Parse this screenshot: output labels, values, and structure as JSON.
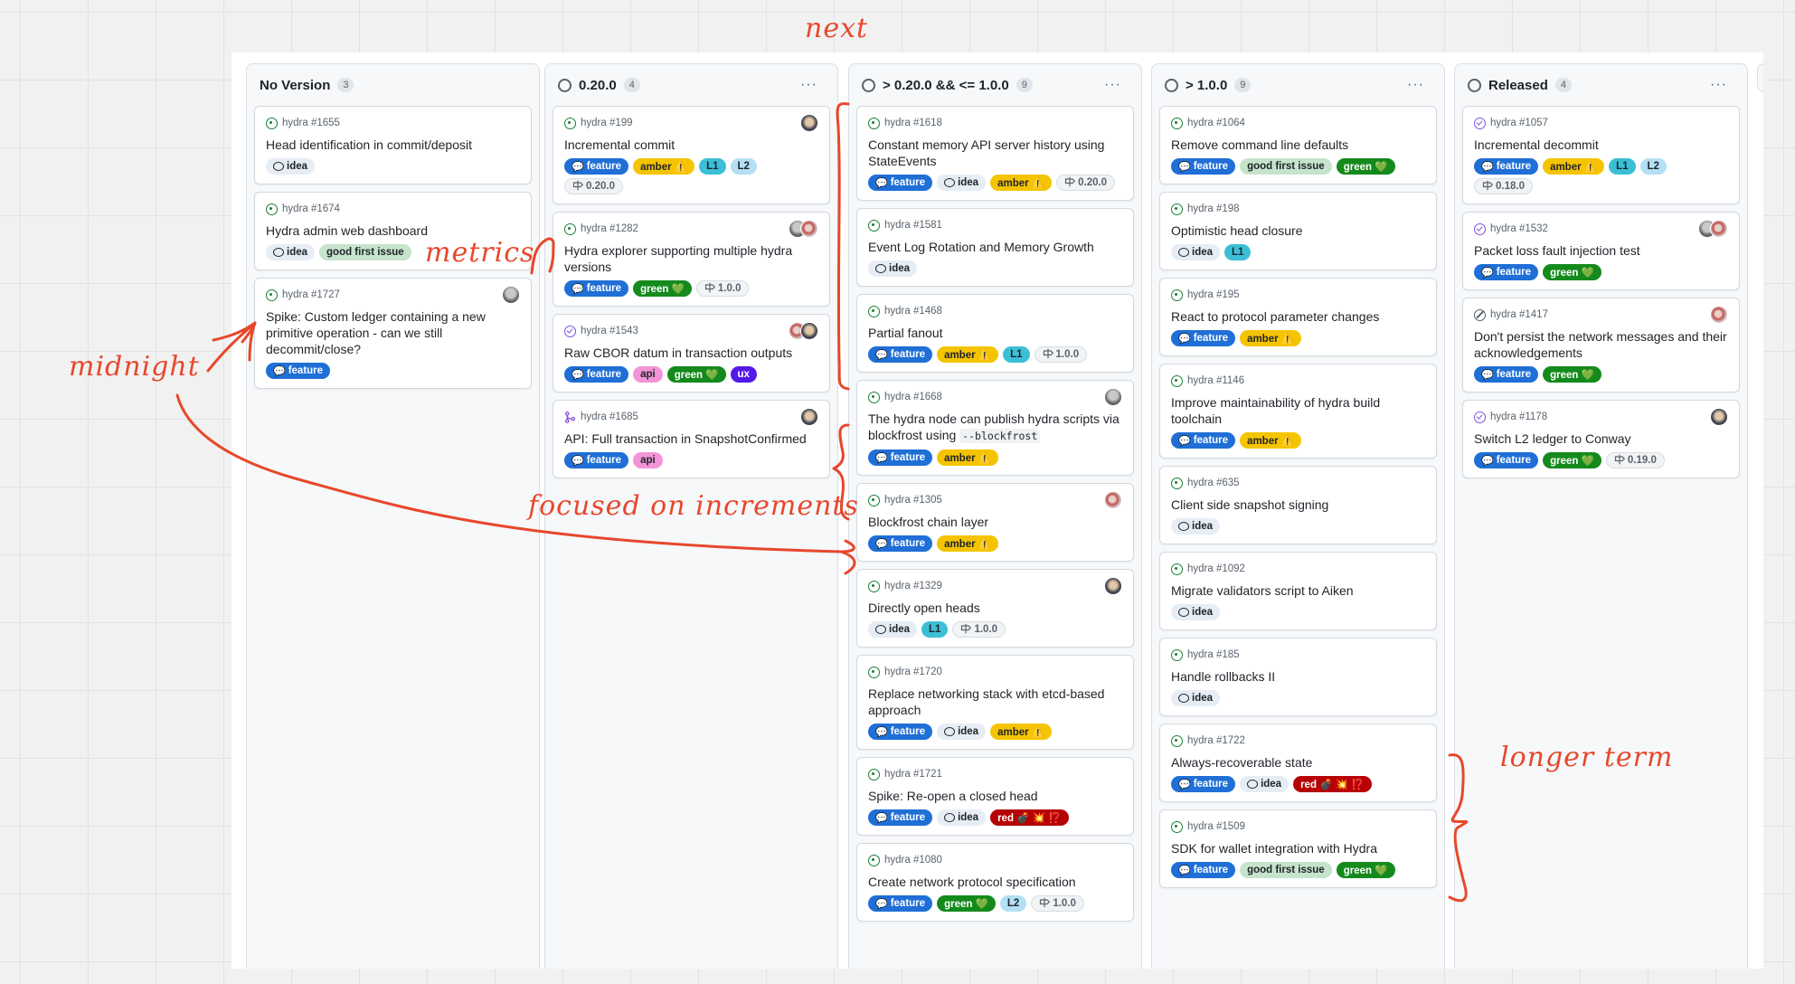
{
  "annotations": {
    "next": "next",
    "metrics": "metrics",
    "midnight": "midnight",
    "focused": "focused on increments",
    "longer_term": "longer term",
    "color": "#e8472b"
  },
  "colors": {
    "open_state": "#1a7f37",
    "closed_state": "#8250df",
    "feature_label": "#1f6fd6",
    "amber_label": "#f5c400",
    "green_label": "#148a1d",
    "red_label": "#b60205"
  },
  "columns": [
    {
      "title": "No Version",
      "count": "3",
      "has_status": false,
      "has_menu": false,
      "cards": [
        {
          "state": "open",
          "ref": "hydra #1655",
          "title": "Head identification in commit/deposit",
          "avatars": 0,
          "labels": [
            {
              "type": "idea",
              "text": "idea"
            }
          ]
        },
        {
          "state": "open",
          "ref": "hydra #1674",
          "title": "Hydra admin web dashboard",
          "avatars": 0,
          "labels": [
            {
              "type": "idea",
              "text": "idea"
            },
            {
              "type": "gfi",
              "text": "good first issue"
            }
          ]
        },
        {
          "state": "open",
          "ref": "hydra #1727",
          "title": "Spike: Custom ledger containing a new primitive operation - can we still decommit/close?",
          "avatars": 1,
          "labels": [
            {
              "type": "feature",
              "text": "feature"
            }
          ]
        }
      ]
    },
    {
      "title": "0.20.0",
      "count": "4",
      "has_status": true,
      "has_menu": true,
      "menu": "···",
      "cards": [
        {
          "state": "open",
          "ref": "hydra #199",
          "title": "Incremental commit",
          "avatars": 1,
          "labels": [
            {
              "type": "feature",
              "text": "feature"
            },
            {
              "type": "amber",
              "text": "amber ⚠️"
            },
            {
              "type": "L1",
              "text": "L1"
            },
            {
              "type": "L2",
              "text": "L2"
            },
            {
              "type": "milestone",
              "text": "0.20.0"
            }
          ]
        },
        {
          "state": "open",
          "ref": "hydra #1282",
          "title": "Hydra explorer supporting multiple hydra versions",
          "avatars": 2,
          "labels": [
            {
              "type": "feature",
              "text": "feature"
            },
            {
              "type": "green",
              "text": "green 💚"
            },
            {
              "type": "milestone",
              "text": "1.0.0"
            }
          ]
        },
        {
          "state": "closed",
          "ref": "hydra #1543",
          "title": "Raw CBOR datum in transaction outputs",
          "avatars": 2,
          "labels": [
            {
              "type": "feature",
              "text": "feature"
            },
            {
              "type": "api",
              "text": "api"
            },
            {
              "type": "green",
              "text": "green 💚"
            },
            {
              "type": "ux",
              "text": "ux"
            }
          ]
        },
        {
          "state": "pr",
          "ref": "hydra #1685",
          "title": "API: Full transaction in SnapshotConfirmed",
          "avatars": 1,
          "labels": [
            {
              "type": "feature",
              "text": "feature"
            },
            {
              "type": "api",
              "text": "api"
            }
          ]
        }
      ]
    },
    {
      "title": "> 0.20.0 && <= 1.0.0",
      "count": "9",
      "has_status": true,
      "has_menu": true,
      "menu": "···",
      "cards": [
        {
          "state": "open",
          "ref": "hydra #1618",
          "title": "Constant memory API server history using StateEvents",
          "avatars": 0,
          "labels": [
            {
              "type": "feature",
              "text": "feature"
            },
            {
              "type": "idea",
              "text": "idea"
            },
            {
              "type": "amber",
              "text": "amber ⚠️"
            },
            {
              "type": "milestone",
              "text": "0.20.0"
            }
          ]
        },
        {
          "state": "open",
          "ref": "hydra #1581",
          "title": "Event Log Rotation and Memory Growth",
          "avatars": 0,
          "labels": [
            {
              "type": "idea",
              "text": "idea"
            }
          ]
        },
        {
          "state": "open",
          "ref": "hydra #1468",
          "title": "Partial fanout",
          "avatars": 0,
          "labels": [
            {
              "type": "feature",
              "text": "feature"
            },
            {
              "type": "amber",
              "text": "amber ⚠️"
            },
            {
              "type": "L1",
              "text": "L1"
            },
            {
              "type": "milestone",
              "text": "1.0.0"
            }
          ]
        },
        {
          "state": "open",
          "ref": "hydra #1668",
          "title": "The hydra node can publish hydra scripts via blockfrost using",
          "code": "--blockfrost",
          "avatars": 1,
          "labels": [
            {
              "type": "feature",
              "text": "feature"
            },
            {
              "type": "amber",
              "text": "amber ⚠️"
            }
          ]
        },
        {
          "state": "open",
          "ref": "hydra #1305",
          "title": "Blockfrost chain layer",
          "avatars": 1,
          "labels": [
            {
              "type": "feature",
              "text": "feature"
            },
            {
              "type": "amber",
              "text": "amber ⚠️"
            }
          ]
        },
        {
          "state": "open",
          "ref": "hydra #1329",
          "title": "Directly open heads",
          "avatars": 1,
          "labels": [
            {
              "type": "idea",
              "text": "idea"
            },
            {
              "type": "L1",
              "text": "L1"
            },
            {
              "type": "milestone",
              "text": "1.0.0"
            }
          ]
        },
        {
          "state": "open",
          "ref": "hydra #1720",
          "title": "Replace networking stack with etcd-based approach",
          "avatars": 0,
          "labels": [
            {
              "type": "feature",
              "text": "feature"
            },
            {
              "type": "idea",
              "text": "idea"
            },
            {
              "type": "amber",
              "text": "amber ⚠️"
            }
          ]
        },
        {
          "state": "open",
          "ref": "hydra #1721",
          "title": "Spike: Re-open a closed head",
          "avatars": 0,
          "labels": [
            {
              "type": "feature",
              "text": "feature"
            },
            {
              "type": "idea",
              "text": "idea"
            },
            {
              "type": "red",
              "text": "red 💣 💥 ⁉️"
            }
          ]
        },
        {
          "state": "open",
          "ref": "hydra #1080",
          "title": "Create network protocol specification",
          "avatars": 0,
          "labels": [
            {
              "type": "feature",
              "text": "feature"
            },
            {
              "type": "green",
              "text": "green 💚"
            },
            {
              "type": "L2",
              "text": "L2"
            },
            {
              "type": "milestone",
              "text": "1.0.0"
            }
          ]
        }
      ]
    },
    {
      "title": "> 1.0.0",
      "count": "9",
      "has_status": true,
      "has_menu": true,
      "menu": "···",
      "cards": [
        {
          "state": "open",
          "ref": "hydra #1064",
          "title": "Remove command line defaults",
          "avatars": 0,
          "labels": [
            {
              "type": "feature",
              "text": "feature"
            },
            {
              "type": "gfi",
              "text": "good first issue"
            },
            {
              "type": "green",
              "text": "green 💚"
            }
          ]
        },
        {
          "state": "open",
          "ref": "hydra #198",
          "title": "Optimistic head closure",
          "avatars": 0,
          "labels": [
            {
              "type": "idea",
              "text": "idea"
            },
            {
              "type": "L1",
              "text": "L1"
            }
          ]
        },
        {
          "state": "open",
          "ref": "hydra #195",
          "title": "React to protocol parameter changes",
          "avatars": 0,
          "labels": [
            {
              "type": "feature",
              "text": "feature"
            },
            {
              "type": "amber",
              "text": "amber ⚠️"
            }
          ]
        },
        {
          "state": "open",
          "ref": "hydra #1146",
          "title": "Improve maintainability of hydra build toolchain",
          "avatars": 0,
          "labels": [
            {
              "type": "feature",
              "text": "feature"
            },
            {
              "type": "amber",
              "text": "amber ⚠️"
            }
          ]
        },
        {
          "state": "open",
          "ref": "hydra #635",
          "title": "Client side snapshot signing",
          "avatars": 0,
          "labels": [
            {
              "type": "idea",
              "text": "idea"
            }
          ]
        },
        {
          "state": "open",
          "ref": "hydra #1092",
          "title": "Migrate validators script to Aiken",
          "avatars": 0,
          "labels": [
            {
              "type": "idea",
              "text": "idea"
            }
          ]
        },
        {
          "state": "open",
          "ref": "hydra #185",
          "title": "Handle rollbacks II",
          "avatars": 0,
          "labels": [
            {
              "type": "idea",
              "text": "idea"
            }
          ]
        },
        {
          "state": "open",
          "ref": "hydra #1722",
          "title": "Always-recoverable state",
          "avatars": 0,
          "labels": [
            {
              "type": "feature",
              "text": "feature"
            },
            {
              "type": "idea",
              "text": "idea"
            },
            {
              "type": "red",
              "text": "red 💣 💥 ⁉️"
            }
          ]
        },
        {
          "state": "open",
          "ref": "hydra #1509",
          "title": "SDK for wallet integration with Hydra",
          "avatars": 0,
          "labels": [
            {
              "type": "feature",
              "text": "feature"
            },
            {
              "type": "gfi",
              "text": "good first issue"
            },
            {
              "type": "green",
              "text": "green 💚"
            }
          ]
        }
      ]
    },
    {
      "title": "Released",
      "count": "4",
      "has_status": true,
      "has_menu": true,
      "menu": "···",
      "cards": [
        {
          "state": "closed",
          "ref": "hydra #1057",
          "title": "Incremental decommit",
          "avatars": 0,
          "labels": [
            {
              "type": "feature",
              "text": "feature"
            },
            {
              "type": "amber",
              "text": "amber ⚠️"
            },
            {
              "type": "L1",
              "text": "L1"
            },
            {
              "type": "L2",
              "text": "L2"
            },
            {
              "type": "milestone",
              "text": "0.18.0"
            }
          ]
        },
        {
          "state": "closed",
          "ref": "hydra #1532",
          "title": "Packet loss fault injection test",
          "avatars": 2,
          "labels": [
            {
              "type": "feature",
              "text": "feature"
            },
            {
              "type": "green",
              "text": "green 💚"
            }
          ]
        },
        {
          "state": "notplanned",
          "ref": "hydra #1417",
          "title": "Don't persist the network messages and their acknowledgements",
          "avatars": 1,
          "labels": [
            {
              "type": "feature",
              "text": "feature"
            },
            {
              "type": "green",
              "text": "green 💚"
            }
          ]
        },
        {
          "state": "closed",
          "ref": "hydra #1178",
          "title": "Switch L2 ledger to Conway",
          "avatars": 1,
          "labels": [
            {
              "type": "feature",
              "text": "feature"
            },
            {
              "type": "green",
              "text": "green 💚"
            },
            {
              "type": "milestone",
              "text": "0.19.0"
            }
          ]
        }
      ]
    }
  ]
}
